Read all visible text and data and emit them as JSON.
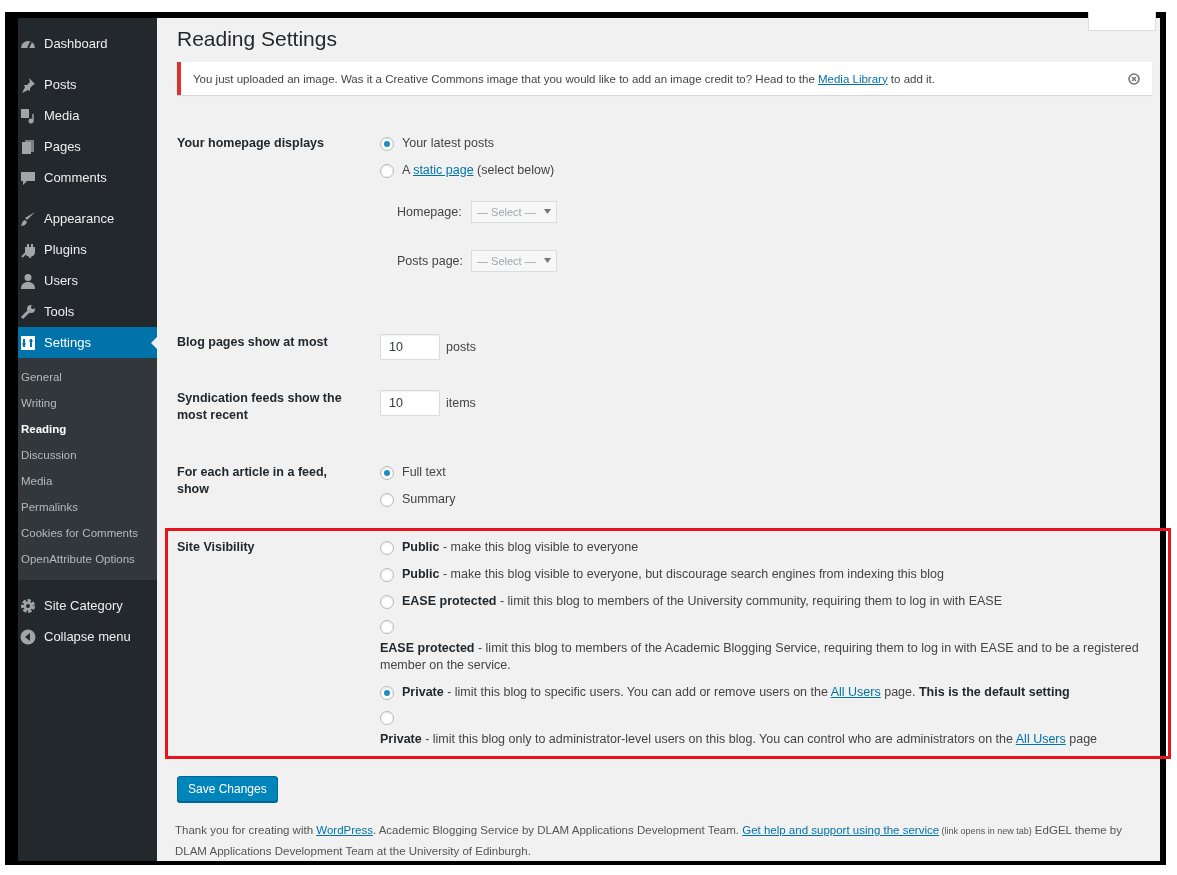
{
  "sidebar": {
    "groups": [
      [
        {
          "label": "Dashboard",
          "selected": false
        }
      ],
      [
        {
          "label": "Posts",
          "selected": false
        },
        {
          "label": "Media",
          "selected": false
        },
        {
          "label": "Pages",
          "selected": false
        },
        {
          "label": "Comments",
          "selected": false
        }
      ],
      [
        {
          "label": "Appearance",
          "selected": false
        },
        {
          "label": "Plugins",
          "selected": false
        },
        {
          "label": "Users",
          "selected": false
        },
        {
          "label": "Tools",
          "selected": false
        },
        {
          "label": "Settings",
          "selected": true,
          "children": [
            {
              "label": "General",
              "selected": false
            },
            {
              "label": "Writing",
              "selected": false
            },
            {
              "label": "Reading",
              "selected": true
            },
            {
              "label": "Discussion",
              "selected": false
            },
            {
              "label": "Media",
              "selected": false
            },
            {
              "label": "Permalinks",
              "selected": false
            },
            {
              "label": "Cookies for Comments",
              "selected": false
            },
            {
              "label": "OpenAttribute Options",
              "selected": false
            }
          ]
        }
      ],
      [
        {
          "label": "Site Category",
          "selected": false
        },
        {
          "label": "Collapse menu",
          "selected": false
        }
      ]
    ]
  },
  "page_title": "Reading Settings",
  "notice": {
    "parts": [
      {
        "kind": "text",
        "text": "You just uploaded an image. Was it a Creative Commons image that you would like to add an image credit to? Head to the "
      },
      {
        "kind": "link",
        "text": "Media Library"
      },
      {
        "kind": "text",
        "text": " to add it."
      }
    ]
  },
  "rows": [
    {
      "kind": "radios",
      "label": "Your homepage displays",
      "highlighted": false,
      "options": [
        {
          "kind": "inline",
          "selected": true,
          "parts": [
            {
              "kind": "text",
              "text": "Your latest posts"
            }
          ]
        },
        {
          "kind": "inline",
          "selected": false,
          "parts": [
            {
              "kind": "text",
              "text": "A "
            },
            {
              "kind": "link",
              "text": "static page"
            },
            {
              "kind": "text",
              "text": " (select below)"
            }
          ]
        }
      ],
      "selects": [
        {
          "label": "Homepage:",
          "placeholder": "— Select —",
          "disabled": true
        },
        {
          "label": "Posts page:",
          "placeholder": "— Select —",
          "disabled": true
        }
      ]
    },
    {
      "kind": "number",
      "label": "Blog pages show at most",
      "highlighted": false,
      "value": "10",
      "suffix": "posts"
    },
    {
      "kind": "number",
      "label": "Syndication feeds show the most recent",
      "highlighted": false,
      "value": "10",
      "suffix": "items"
    },
    {
      "kind": "radios",
      "label": "For each article in a feed, show",
      "highlighted": false,
      "options": [
        {
          "kind": "inline",
          "selected": true,
          "parts": [
            {
              "kind": "text",
              "text": "Full text"
            }
          ]
        },
        {
          "kind": "inline",
          "selected": false,
          "parts": [
            {
              "kind": "text",
              "text": "Summary"
            }
          ]
        }
      ]
    },
    {
      "kind": "radios",
      "label": "Site Visibility",
      "highlighted": true,
      "options": [
        {
          "kind": "inline",
          "selected": false,
          "parts": [
            {
              "kind": "text",
              "text": "**Public** - make this blog visible to everyone"
            }
          ]
        },
        {
          "kind": "inline",
          "selected": false,
          "parts": [
            {
              "kind": "text",
              "text": "**Public** - make this blog visible to everyone, but discourage search engines from indexing this blog"
            }
          ]
        },
        {
          "kind": "inline",
          "selected": false,
          "parts": [
            {
              "kind": "text",
              "text": "**EASE protected** - limit this blog to members of the University community, requiring them to log in with EASE"
            }
          ]
        },
        {
          "kind": "stacked",
          "selected": false,
          "parts": [
            {
              "kind": "text",
              "text": "**EASE protected** - limit this blog to members of the Academic Blogging Service, requiring them to log in with EASE and to be a registered member on the service."
            }
          ]
        },
        {
          "kind": "inline",
          "selected": true,
          "parts": [
            {
              "kind": "text",
              "text": "**Private** - limit this blog to specific users. You can add or remove users on the "
            },
            {
              "kind": "link",
              "text": "All Users"
            },
            {
              "kind": "text",
              "text": " page. **This is the default setting**"
            }
          ]
        },
        {
          "kind": "stacked",
          "selected": false,
          "parts": [
            {
              "kind": "text",
              "text": "**Private** - limit this blog only to administrator-level users on this blog. You can control who are administrators on the "
            },
            {
              "kind": "link",
              "text": "All Users"
            },
            {
              "kind": "text",
              "text": " page"
            }
          ]
        }
      ]
    }
  ],
  "save_button": "Save Changes",
  "footer": {
    "parts": [
      {
        "kind": "text",
        "text": "Thank you for creating with "
      },
      {
        "kind": "link",
        "text": "WordPress"
      },
      {
        "kind": "text",
        "text": ". Academic Blogging Service by DLAM Applications Development Team. "
      },
      {
        "kind": "link",
        "text": "Get help and support using the service"
      },
      {
        "kind": "note",
        "text": " (link opens in new tab)"
      },
      {
        "kind": "text",
        "text": " EdGEL theme by DLAM Applications Development Team at the University of Edinburgh."
      }
    ]
  }
}
